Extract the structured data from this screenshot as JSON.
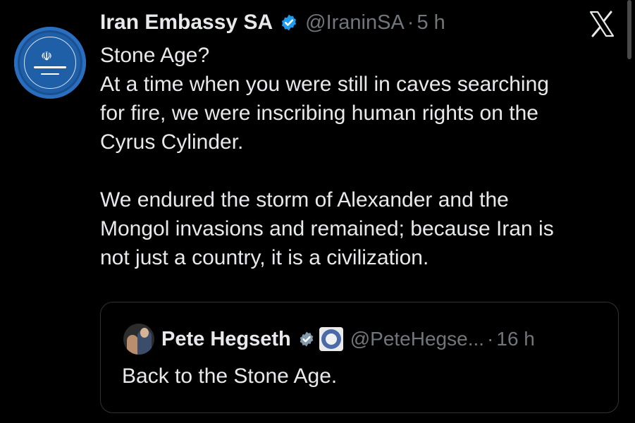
{
  "tweet": {
    "author_name": "Iran Embassy SA",
    "handle": "@IraninSA",
    "separator": "·",
    "time": "5 h",
    "lines_para1": [
      "Stone Age?",
      "At a time when you were still in caves searching",
      "for fire, we were inscribing human rights on the",
      "Cyrus Cylinder."
    ],
    "lines_para2": [
      "We endured the storm of Alexander and the",
      "Mongol invasions and remained; because Iran is",
      "not just a country, it is a civilization."
    ]
  },
  "quoted_tweet": {
    "author_name": "Pete Hegseth",
    "handle": "@PeteHegse...",
    "separator": "·",
    "time": "16 h",
    "text": "Back to the Stone Age."
  },
  "icons": {
    "verified": "verified-badge-icon",
    "x_logo": "x-logo-icon",
    "affiliate_seal": "department-seal-icon"
  },
  "colors": {
    "background": "#000000",
    "text": "#e7e9ea",
    "muted": "#71767b",
    "verified_blue": "#1d9bf0",
    "verified_gray": "#829aab",
    "avatar_blue": "#1f5fa8"
  }
}
